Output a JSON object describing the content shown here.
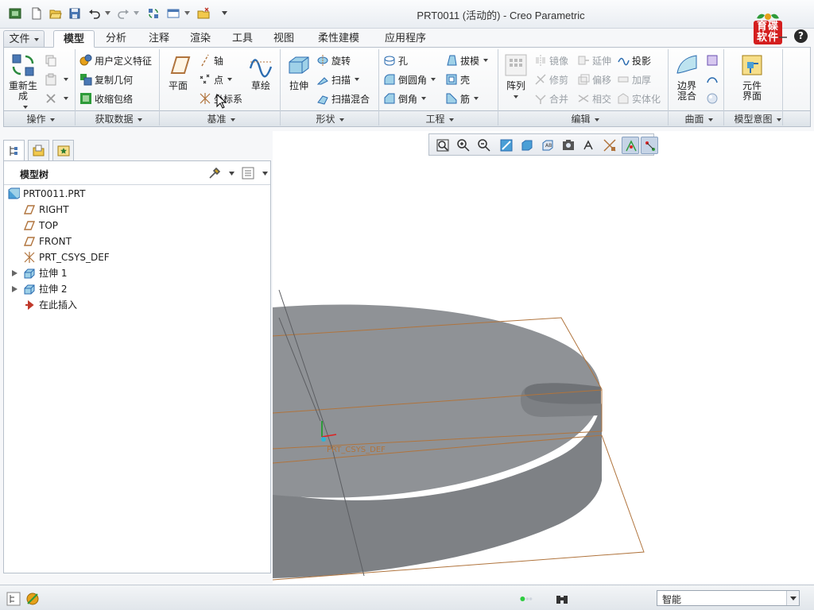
{
  "window": {
    "title": "PRT0011 (活动的) - Creo Parametric",
    "logo_text": "育碟软件",
    "help": "?"
  },
  "quick_access": {
    "icons": [
      "app-icon",
      "new-file-icon",
      "open-folder-icon",
      "save-icon",
      "undo-icon",
      "redo-icon",
      "regenerate-icon",
      "windows-icon",
      "close-window-icon",
      "customize-icon"
    ]
  },
  "tabs": [
    {
      "label": "文件"
    },
    {
      "label": "模型"
    },
    {
      "label": "分析"
    },
    {
      "label": "注释"
    },
    {
      "label": "渲染"
    },
    {
      "label": "工具"
    },
    {
      "label": "视图"
    },
    {
      "label": "柔性建模"
    },
    {
      "label": "应用程序"
    }
  ],
  "ribbon": {
    "operations": {
      "regenerate_label": "重新生成",
      "group": "操作"
    },
    "get_data": {
      "user_defined_feature": "用户定义特征",
      "copy_geometry": "复制几何",
      "shrinkwrap": "收缩包络",
      "group": "获取数据"
    },
    "datum": {
      "plane": "平面",
      "axis": "轴",
      "point": "点",
      "csys": "坐标系",
      "sketch": "草绘",
      "group": "基准"
    },
    "shapes": {
      "extrude": "拉伸",
      "revolve": "旋转",
      "sweep": "扫描",
      "swept_blend": "扫描混合",
      "group": "形状"
    },
    "engineering": {
      "hole": "孔",
      "round": "倒圆角",
      "chamfer": "倒角",
      "draft": "拔模",
      "shell": "壳",
      "rib": "筋",
      "group": "工程"
    },
    "editing": {
      "pattern": "阵列",
      "mirror": "镜像",
      "trim": "修剪",
      "merge": "合并",
      "extend": "延伸",
      "offset": "偏移",
      "intersect": "相交",
      "project": "投影",
      "thicken": "加厚",
      "solidify": "实体化",
      "group": "编辑"
    },
    "surfaces": {
      "boundary_blend": "边界混合",
      "group": "曲面"
    },
    "model_intent": {
      "component_interface": "元件界面",
      "group": "模型意图"
    }
  },
  "model_tree": {
    "title": "模型树",
    "items": [
      {
        "label": "PRT0011.PRT",
        "icon": "part-icon"
      },
      {
        "label": "RIGHT",
        "icon": "datum-plane-icon"
      },
      {
        "label": "TOP",
        "icon": "datum-plane-icon"
      },
      {
        "label": "FRONT",
        "icon": "datum-plane-icon"
      },
      {
        "label": "PRT_CSYS_DEF",
        "icon": "csys-icon"
      },
      {
        "label": "拉伸 1",
        "icon": "extrude-icon"
      },
      {
        "label": "拉伸 2",
        "icon": "extrude-icon"
      },
      {
        "label": "在此插入",
        "icon": "insert-arrow-icon"
      }
    ]
  },
  "graphics": {
    "csys_label": "PRT_CSYS_DEF",
    "view_tools": [
      "refit-icon",
      "zoom-in-icon",
      "zoom-out-icon",
      "repaint-icon",
      "display-style-icon",
      "saved-views-icon",
      "view-manager-icon",
      "perspective-icon",
      "datum-display-icon",
      "spin-center-icon",
      "annotation-display-icon"
    ],
    "colors": {
      "model": "#8f9296",
      "model_top": "#86898d",
      "datum_plane": "#b0743d",
      "background": "#ffffff"
    }
  },
  "status_bar": {
    "filter_value": "智能"
  }
}
